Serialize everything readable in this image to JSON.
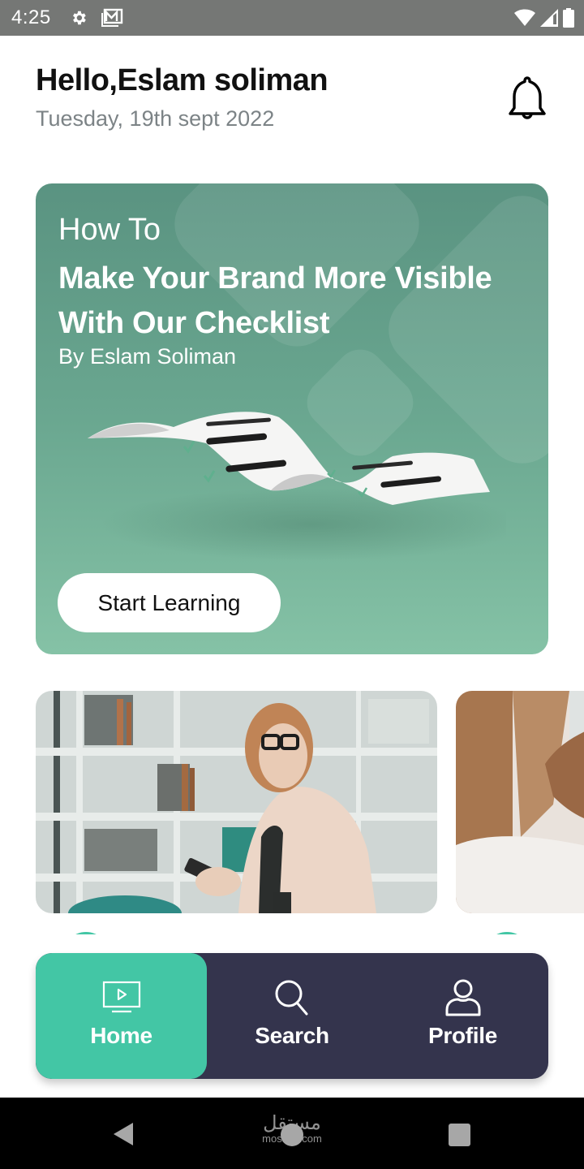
{
  "status_bar": {
    "time": "4:25",
    "left_icons": [
      "settings-gear-icon",
      "gmail-icon"
    ],
    "right_icons": [
      "wifi-icon",
      "cell-signal-icon",
      "battery-icon"
    ]
  },
  "header": {
    "greeting": "Hello,Eslam soliman",
    "date": "Tuesday, 19th sept 2022",
    "notification_icon": "bell-icon"
  },
  "hero": {
    "eyebrow": "How To",
    "title": "Make Your Brand More Visible With Our Checklist",
    "author": "By Eslam Soliman",
    "illustration": "wavy-checklist-illustration",
    "cta_label": "Start Learning",
    "colors": {
      "top": "#5a9381",
      "bottom": "#85c2a6"
    }
  },
  "courses": [
    {
      "image": "woman-with-phone-in-library-photo"
    },
    {
      "image": "woman-with-brown-hair-photo"
    }
  ],
  "bottom_nav": {
    "items": [
      {
        "label": "Home",
        "icon": "tv-play-icon",
        "active": true
      },
      {
        "label": "Search",
        "icon": "search-icon",
        "active": false
      },
      {
        "label": "Profile",
        "icon": "user-icon",
        "active": false
      }
    ],
    "colors": {
      "background": "#34344d",
      "active": "#43c6a5"
    }
  },
  "system_nav": {
    "buttons": [
      "back",
      "home",
      "recents"
    ],
    "watermark_arabic": "مستقل",
    "watermark_latin": "mostaql.com"
  }
}
